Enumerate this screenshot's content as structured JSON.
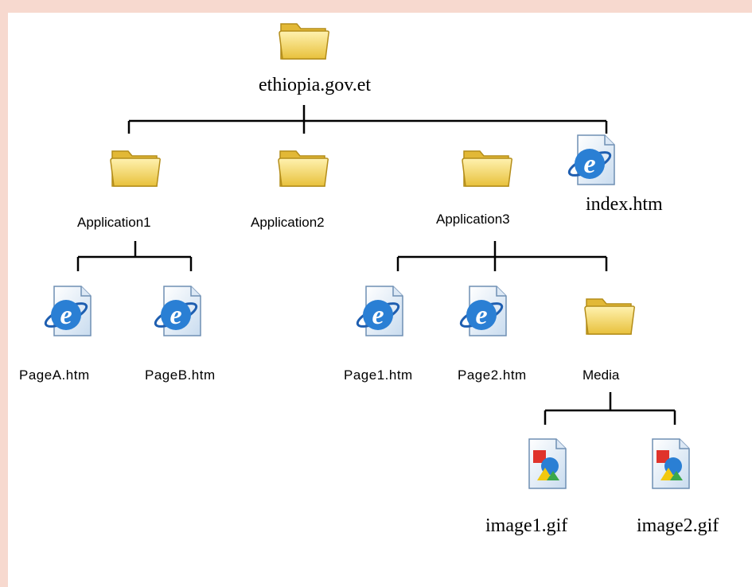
{
  "root": {
    "label": "ethiopia.gov.et",
    "icon": "folder-icon"
  },
  "level1": [
    {
      "label": "Application1",
      "icon": "folder-icon"
    },
    {
      "label": "Application2",
      "icon": "folder-icon"
    },
    {
      "label": "Application3",
      "icon": "folder-icon"
    },
    {
      "label": "index.htm",
      "icon": "ie-page-icon"
    }
  ],
  "application1_children": [
    {
      "label": "PageA.htm",
      "icon": "ie-page-icon"
    },
    {
      "label": "PageB.htm",
      "icon": "ie-page-icon"
    }
  ],
  "application3_children": [
    {
      "label": "Page1.htm",
      "icon": "ie-page-icon"
    },
    {
      "label": "Page2.htm",
      "icon": "ie-page-icon"
    },
    {
      "label": "Media",
      "icon": "folder-icon"
    }
  ],
  "media_children": [
    {
      "label": "image1.gif",
      "icon": "gif-image-icon"
    },
    {
      "label": "image2.gif",
      "icon": "gif-image-icon"
    }
  ],
  "colors": {
    "frame": "#f7d9cf",
    "folder": "#f3d45e",
    "ie_blue": "#2a7fd4"
  }
}
